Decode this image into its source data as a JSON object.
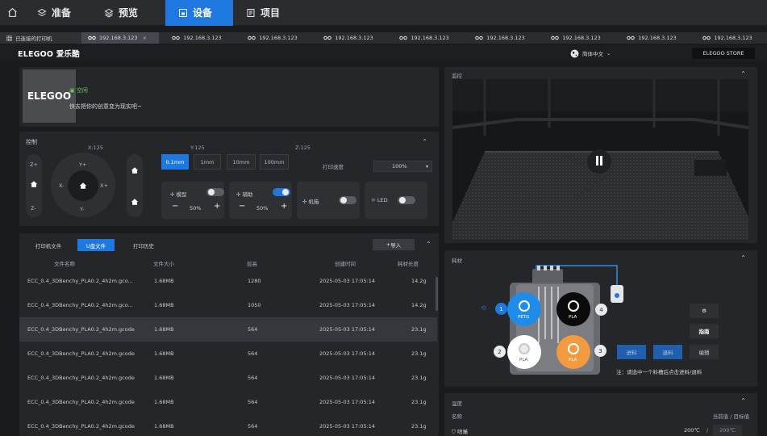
{
  "nav": {
    "items": [
      "准备",
      "预览",
      "设备",
      "项目"
    ],
    "active_index": 2
  },
  "tabs": {
    "first": "已连接的打印机",
    "active": "192.168.3.123",
    "others": [
      "192.168.3.123",
      "192.168.3.123",
      "192.168.3.123",
      "192.168.3.123",
      "192.168.3.123",
      "192.168.3.123",
      "192.168.3.123",
      "192.168.3.123"
    ]
  },
  "brandbar": {
    "brand": "ELEGOO 爱乐酷",
    "language": "简体中文",
    "store": "ELEGOO STORE"
  },
  "printer": {
    "logo": "ELEGOO",
    "status": "空闲",
    "tagline": "快去把你的创意变为现实吧~"
  },
  "control": {
    "title": "控制",
    "x_label": "X:125",
    "y_label": "Y:125",
    "z_label": "Z:125",
    "steps": [
      "0.1mm",
      "1mm",
      "10mm",
      "100mm"
    ],
    "active_step": "0.1mm",
    "speed_label": "打印速度",
    "speed_value": "100%",
    "jog": {
      "zplus": "Z+",
      "zminus": "Z-",
      "yplus": "Y+",
      "yminus": "Y-",
      "xminus": "X-",
      "xplus": "X+"
    },
    "fans": [
      {
        "label": "模型",
        "on": false,
        "value": "50%"
      },
      {
        "label": "辅助",
        "on": true,
        "value": "50%"
      },
      {
        "label": "机箱",
        "on": false
      },
      {
        "label": "LED",
        "on": false
      }
    ]
  },
  "files": {
    "tabs": [
      "打印机文件",
      "U盘文件",
      "打印历史"
    ],
    "active_tab": "U盘文件",
    "import_label": "导入",
    "headers": [
      "文件名称",
      "文件大小",
      "层高",
      "创建时间",
      "耗材长度"
    ],
    "rows": [
      {
        "name": "ECC_0.4_3DBenchy_PLA0.2_4h2m.gco...",
        "size": "1.68MB",
        "layers": "1280",
        "time": "2025-05-03 17:05:14",
        "length": "14.2g"
      },
      {
        "name": "ECC_0.4_3DBenchy_PLA0.2_4h2m.gco...",
        "size": "1.68MB",
        "layers": "1050",
        "time": "2025-05-03 17:05:14",
        "length": "14.2g"
      },
      {
        "name": "ECC_0.4_3DBenchy_PLA0.2_4h2m.gcode",
        "size": "1.68MB",
        "layers": "564",
        "time": "2025-05-03 17:05:14",
        "length": "23.1g"
      },
      {
        "name": "ECC_0.4_3DBenchy_PLA0.2_4h2m.gcode",
        "size": "1.68MB",
        "layers": "564",
        "time": "2025-05-03 17:05:14",
        "length": "23.1g"
      },
      {
        "name": "ECC_0.4_3DBenchy_PLA0.2_4h2m.gcode",
        "size": "1.68MB",
        "layers": "564",
        "time": "2025-05-03 17:05:14",
        "length": "23.1g"
      },
      {
        "name": "ECC_0.4_3DBenchy_PLA0.2_4h2m.gcode",
        "size": "1.68MB",
        "layers": "564",
        "time": "2025-05-03 17:05:14",
        "length": "23.1g"
      },
      {
        "name": "ECC_0.4_3DBenchy_PLA0.2_4h2m.gcode",
        "size": "1.68MB",
        "layers": "564",
        "time": "2025-05-03 17:05:14",
        "length": "23.1g"
      }
    ],
    "selected_index": 2
  },
  "monitor": {
    "title": "监控"
  },
  "filament": {
    "title": "耗材",
    "slots": [
      {
        "num": "1",
        "material": "PETG",
        "color": "#1f8de8",
        "active": true
      },
      {
        "num": "2",
        "material": "PLA",
        "color": "#ffffff"
      },
      {
        "num": "3",
        "material": "PLA",
        "color": "#f29a3f"
      },
      {
        "num": "4",
        "material": "PLA",
        "color": "#0b0b0c"
      }
    ],
    "buttons": [
      "进料",
      "退料",
      "编辑"
    ],
    "guide": "指南",
    "note": "注：请选中一个料槽后点击进料/退料"
  },
  "temperature": {
    "title": "温度",
    "col_name": "名称",
    "col_value": "当前值 / 目标值",
    "rows": [
      {
        "name": "喷嘴",
        "current": "200℃",
        "target": "200℃"
      }
    ]
  },
  "colors": {
    "accent": "#1f77e0",
    "bg": "#1a1b1e",
    "panel": "#25262a",
    "status_green": "#63c95a"
  }
}
